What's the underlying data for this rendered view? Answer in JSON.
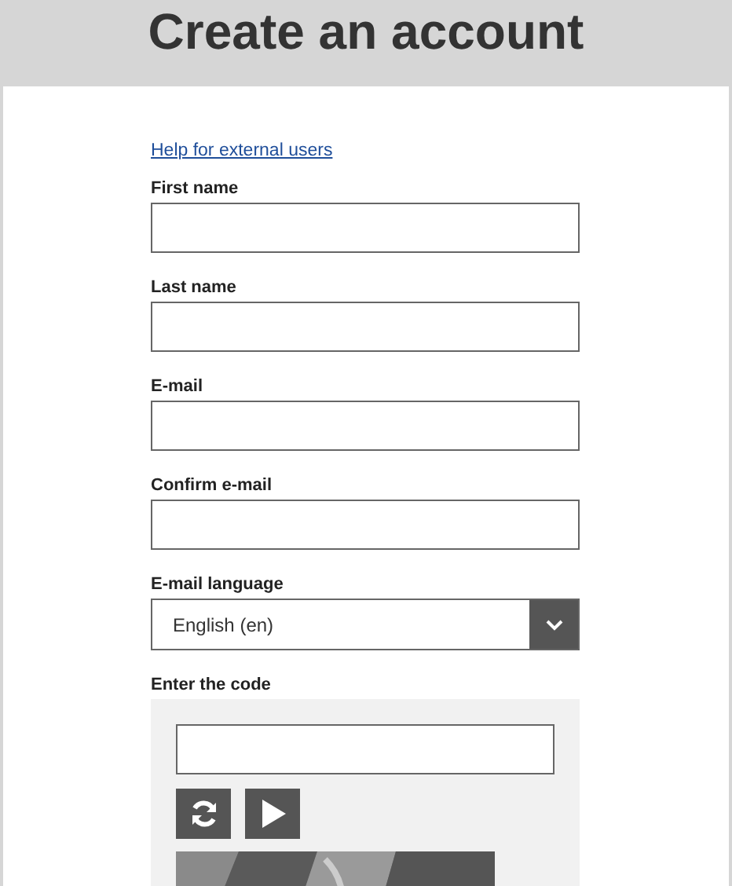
{
  "header": {
    "title": "Create an account"
  },
  "help_link": "Help for external users",
  "fields": [
    {
      "kind": "text",
      "label": "First name"
    },
    {
      "kind": "text",
      "label": "Last name"
    },
    {
      "kind": "text",
      "label": "E-mail"
    },
    {
      "kind": "text",
      "label": "Confirm e-mail"
    },
    {
      "kind": "select",
      "label": "E-mail language",
      "value": "English (en)"
    }
  ],
  "captcha": {
    "label": "Enter the code"
  }
}
